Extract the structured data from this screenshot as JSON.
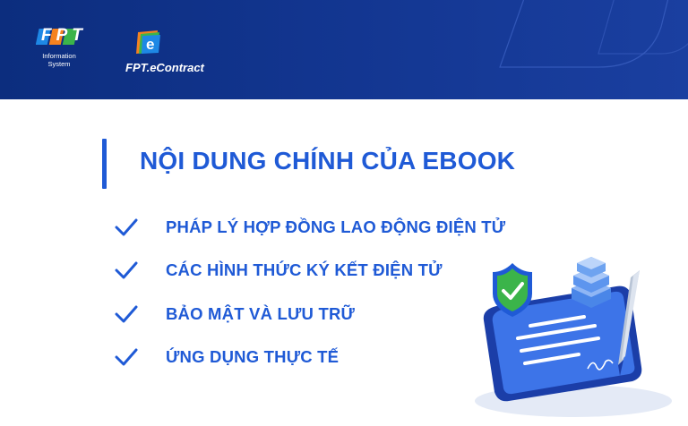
{
  "header": {
    "fpt_logo_text": "FPT",
    "fpt_subtitle_line1": "Information",
    "fpt_subtitle_line2": "System",
    "econtract_name": "FPT.eContract",
    "econtract_icon_letter": "e",
    "colors": {
      "background": "#12358f",
      "accent_orange": "#f5821f",
      "accent_green": "#3bb44a",
      "accent_blue": "#1e88e5"
    }
  },
  "main": {
    "title": "NỘI DUNG CHÍNH CỦA EBOOK",
    "items": [
      {
        "icon": "checkmark-icon",
        "label": "PHÁP LÝ HỢP ĐỒNG LAO ĐỘNG ĐIỆN TỬ"
      },
      {
        "icon": "checkmark-icon",
        "label": "CÁC HÌNH THỨC KÝ KẾT ĐIỆN TỬ"
      },
      {
        "icon": "checkmark-icon",
        "label": "BẢO MẬT VÀ LƯU TRỮ"
      },
      {
        "icon": "checkmark-icon",
        "label": "ỨNG DỤNG THỰC TẾ"
      }
    ],
    "accent_color": "#1f5ad6"
  },
  "illustration": {
    "icons": [
      "shield-check-icon",
      "database-stack-icon",
      "smartphone-document-icon",
      "pen-icon",
      "signature-icon"
    ]
  }
}
